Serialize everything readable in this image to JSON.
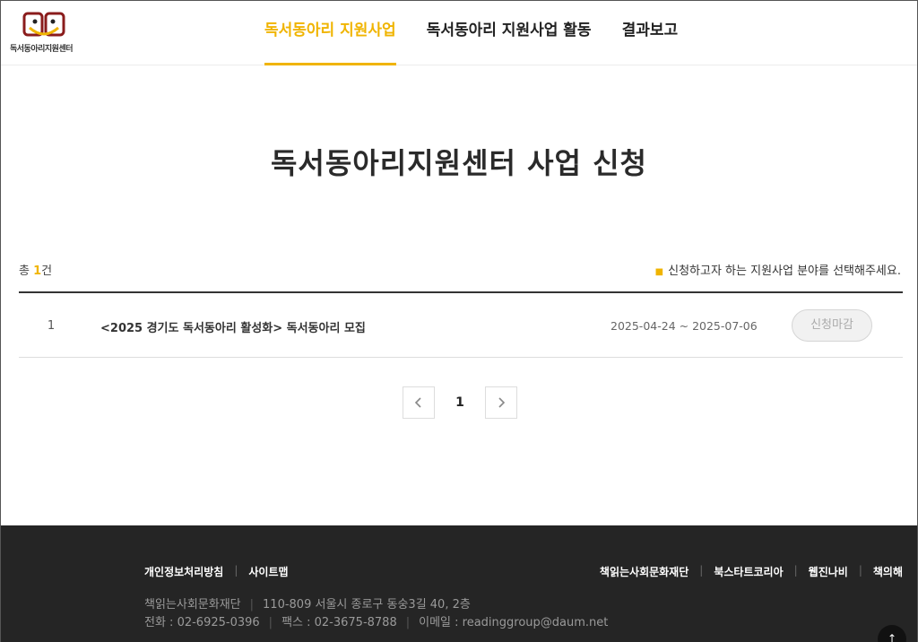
{
  "header": {
    "logo_text": "독서동아리지원센터",
    "nav": [
      {
        "label": "독서동아리 지원사업"
      },
      {
        "label": "독서동아리 지원사업 활동"
      },
      {
        "label": "결과보고"
      }
    ],
    "active_index": 0
  },
  "main": {
    "title": "독서동아리지원센터 사업 신청",
    "total_prefix": "총 ",
    "total_count": "1",
    "total_suffix": "건",
    "guide_bullet": "■",
    "guide": "신청하고자 하는 지원사업 분야를 선택해주세요.",
    "rows": [
      {
        "num": "1",
        "title": "<2025 경기도 독서동아리 활성화> 독서동아리 모집",
        "period": "2025-04-24 ~ 2025-07-06",
        "status": "신청마감"
      }
    ],
    "pagination": {
      "current": "1"
    }
  },
  "footer": {
    "links": [
      "개인정보처리방침",
      "사이트맵"
    ],
    "right_links": [
      "책읽는사회문화재단",
      "북스타트코리아",
      "웹진나비",
      "책의해"
    ],
    "org": "책읽는사회문화재단",
    "address": "110-809 서울시 종로구 동숭3길 40, 2층",
    "phone": "전화 : 02-6925-0396",
    "fax": "팩스 : 02-3675-8788",
    "email": "이메일 : readinggroup@daum.net",
    "top_button": "↑"
  },
  "colors": {
    "accent": "#f0b400",
    "footer_bg": "#252525"
  }
}
